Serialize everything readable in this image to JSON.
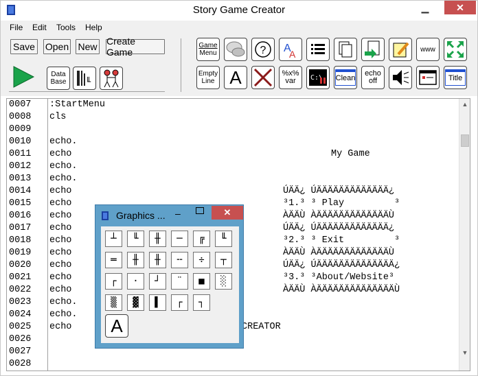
{
  "window": {
    "title": "Story Game Creator"
  },
  "menu": [
    "File",
    "Edit",
    "Tools",
    "Help"
  ],
  "toolbar": {
    "save": "Save",
    "open": "Open",
    "new": "New",
    "create_game": "Create Game",
    "database": [
      "Data",
      "Base"
    ],
    "game_menu": [
      "Game",
      "Menu"
    ],
    "empty_line": [
      "Empty",
      "Line"
    ],
    "font_letter": "A",
    "var": [
      "%x%",
      "var"
    ],
    "clean": "Clean",
    "echo_off": [
      "echo",
      "off"
    ],
    "www": "www",
    "title": "Title"
  },
  "editor": {
    "line_numbers": [
      "0007",
      "0008",
      "0009",
      "0010",
      "0011",
      "0012",
      "0013",
      "0014",
      "0015",
      "0016",
      "0017",
      "0018",
      "0019",
      "0020",
      "0021",
      "0022",
      "0023",
      "0024",
      "0025",
      "0026",
      "0027",
      "0028"
    ],
    "lines": [
      ":StartMenu",
      "cls",
      "",
      "echo.",
      "echo",
      "echo.",
      "echo.",
      "echo",
      "echo",
      "echo",
      "echo",
      "echo",
      "echo",
      "echo",
      "echo",
      "echo",
      "echo.",
      "echo.",
      "echo",
      "",
      "",
      ""
    ],
    "right_text": [
      {
        "row": 4,
        "col": 410,
        "text": "My Game"
      },
      {
        "row": 7,
        "col": 340,
        "text": "ÚÄÄ¿ ÚÄÄÄÄÄÄÄÄÄÄÄÄÄ¿"
      },
      {
        "row": 8,
        "col": 340,
        "text": "³1.³ ³ Play         ³"
      },
      {
        "row": 9,
        "col": 340,
        "text": "ÀÄÄÙ ÀÄÄÄÄÄÄÄÄÄÄÄÄÄÙ"
      },
      {
        "row": 10,
        "col": 340,
        "text": "ÚÄÄ¿ ÚÄÄÄÄÄÄÄÄÄÄÄÄÄ¿"
      },
      {
        "row": 11,
        "col": 340,
        "text": "³2.³ ³ Exit         ³"
      },
      {
        "row": 12,
        "col": 340,
        "text": "ÀÄÄÙ ÀÄÄÄÄÄÄÄÄÄÄÄÄÄÙ"
      },
      {
        "row": 13,
        "col": 340,
        "text": "ÚÄÄ¿ ÚÄÄÄÄÄÄÄÄÄÄÄÄÄÄ¿"
      },
      {
        "row": 14,
        "col": 340,
        "text": "³3.³ ³About/Website³"
      },
      {
        "row": 15,
        "col": 340,
        "text": "ÀÄÄÙ ÀÄÄÄÄÄÄÄÄÄÄÄÄÄÄÙ"
      },
      {
        "row": 18,
        "col": 280,
        "text": "CREATOR"
      }
    ]
  },
  "graphics": {
    "title": "Graphics ...",
    "close": "✕",
    "glyphs": [
      "┴",
      "╙",
      "╫",
      "─",
      "╔",
      "╙",
      "═",
      "╫",
      "╫",
      "╌",
      "÷",
      "┬",
      "┌",
      "·",
      "┘",
      "¨",
      "■",
      "░",
      "▒",
      "▓",
      "▌",
      "┌",
      "┐"
    ],
    "big": "A"
  }
}
